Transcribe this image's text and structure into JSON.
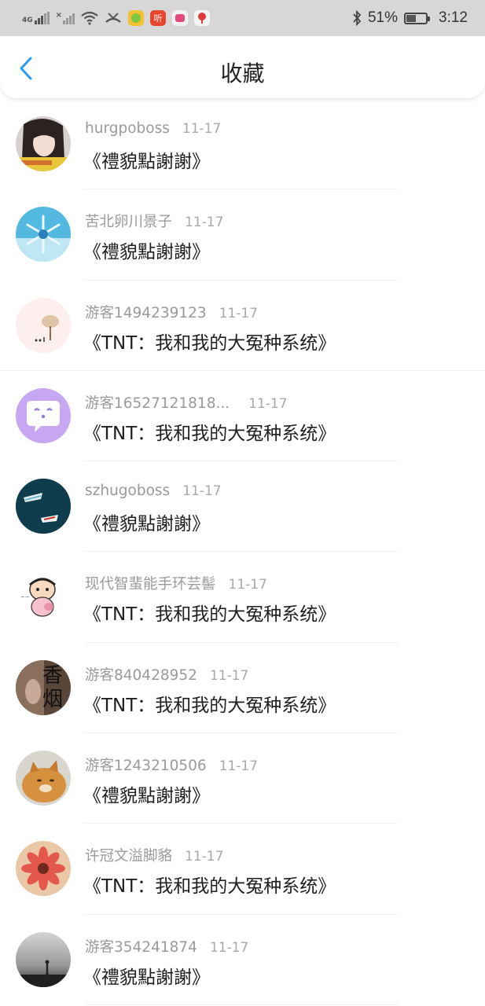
{
  "status_bar": {
    "network_left": "4G",
    "battery_percent": "51%",
    "battery_level": 0.51,
    "time": "3:12",
    "icons": [
      "signal-icon",
      "no-sim-signal-icon",
      "wifi-icon",
      "missed-call-icon",
      "app-icon-green",
      "app-icon-listen",
      "app-icon-pink",
      "app-icon-red",
      "bluetooth-icon",
      "battery-icon"
    ],
    "app_listen_text": "听"
  },
  "header": {
    "title": "收藏",
    "back_icon": "chevron-left-icon",
    "accent_color": "#2b9cf2"
  },
  "items": [
    {
      "user": "hurgpoboss",
      "date": "11-17",
      "title": "《禮貌點謝謝》",
      "avatar": "avatar-photo-girl"
    },
    {
      "user": "苦北卵川景子",
      "date": "11-17",
      "title": "《禮貌點謝謝》",
      "avatar": "avatar-snowflake"
    },
    {
      "user": "游客1494239123",
      "date": "11-17",
      "title": "《TNT：我和我的大冤种系统》",
      "avatar": "avatar-tree-drawing"
    },
    {
      "user": "游客16527121818...",
      "date": "11-17",
      "title": "《TNT：我和我的大冤种系统》",
      "avatar": "avatar-chat-bubble"
    },
    {
      "user": "szhugoboss",
      "date": "11-17",
      "title": "《禮貌點謝謝》",
      "avatar": "avatar-boats"
    },
    {
      "user": "现代智蜚能手环芸髻",
      "date": "11-17",
      "title": "《TNT：我和我的大冤种系统》",
      "avatar": "avatar-cartoon-kid"
    },
    {
      "user": "游客840428952",
      "date": "11-17",
      "title": "《TNT：我和我的大冤种系统》",
      "avatar": "avatar-xiangyan",
      "avatar_text": "香烟"
    },
    {
      "user": "游客1243210506",
      "date": "11-17",
      "title": "《禮貌點謝謝》",
      "avatar": "avatar-cat"
    },
    {
      "user": "许冠文溢脚貉",
      "date": "11-17",
      "title": "《TNT：我和我的大冤种系统》",
      "avatar": "avatar-flower"
    },
    {
      "user": "游客354241874",
      "date": "11-17",
      "title": "《禮貌點謝謝》",
      "avatar": "avatar-foggy-figure"
    }
  ]
}
